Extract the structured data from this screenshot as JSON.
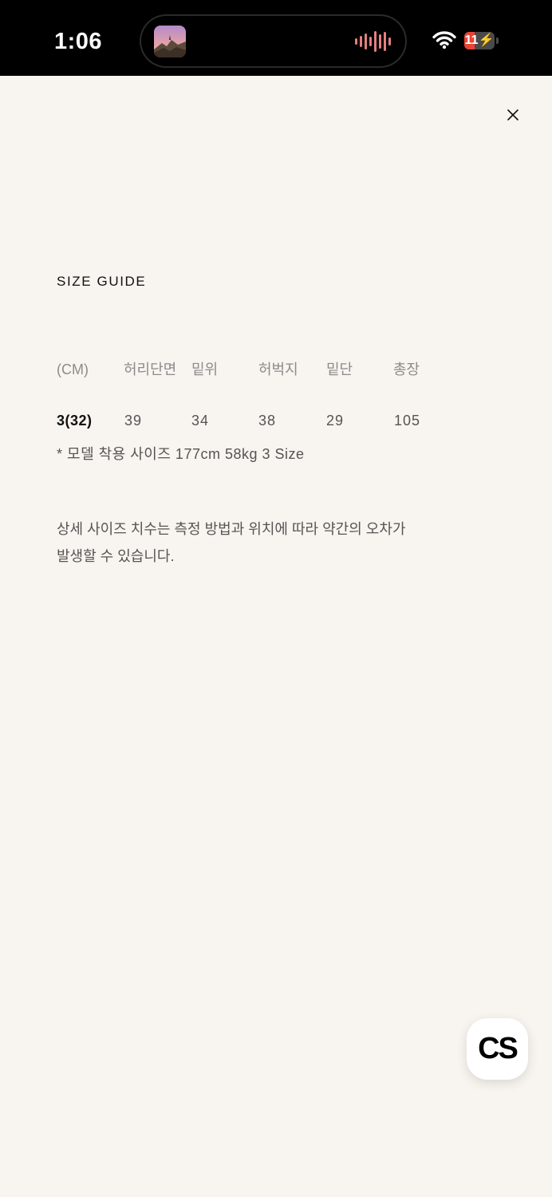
{
  "status_bar": {
    "time": "1:06",
    "battery_level": "11",
    "battery_fraction": 0.11
  },
  "modal": {
    "close_icon": "close-icon",
    "title": "SIZE GUIDE",
    "table": {
      "headers": [
        "(CM)",
        "허리단면",
        "밑위",
        "허벅지",
        "밑단",
        "총장"
      ],
      "rows": [
        [
          "3(32)",
          "39",
          "34",
          "38",
          "29",
          "105"
        ]
      ]
    },
    "model_note": "* 모델 착용 사이즈 177cm 58kg 3 Size",
    "description_lines": [
      "상세 사이즈 치수는 측정 방법과 위치에 따라 약간의 오차가",
      "발생할 수 있습니다."
    ]
  },
  "cs_button": {
    "label": "CS"
  },
  "colors": {
    "background": "#f8f4ef",
    "status_bar": "#000000",
    "battery_low": "#ea4335",
    "text_primary": "#111111",
    "text_secondary": "#555555",
    "text_muted": "#8c8c8c"
  }
}
